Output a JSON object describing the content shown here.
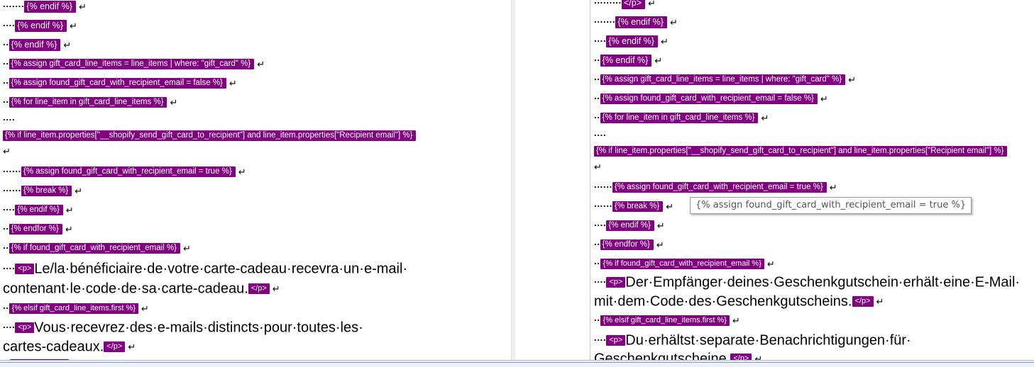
{
  "glyphs": {
    "return_icon": "↵",
    "dot": "·"
  },
  "colors": {
    "tag_bg": "#800080",
    "tag_text": "#ffffff"
  },
  "source": {
    "lines": [
      {
        "indent": "·······",
        "tag": "{% endif %}"
      },
      {
        "indent": "····",
        "tag": "{% endif %}"
      },
      {
        "indent": "··",
        "tag": "{% endif %}"
      },
      {
        "indent": "··",
        "tag": "{% assign gift_card_line_items = line_items | where: \"gift_card\" %}"
      },
      {
        "indent": "··",
        "tag": "{% assign found_gift_card_with_recipient_email = false %}"
      },
      {
        "indent": "··",
        "tag": "{% for line_item in gift_card_line_items %}"
      },
      {
        "indent": "····"
      },
      {
        "tag": "{% if line_item.properties[\"__shopify_send_gift_card_to_recipient\"] and line_item.properties[\"Recipient email\"] %}"
      },
      {
        "indent": "······",
        "tag": "{% assign found_gift_card_with_recipient_email = true %}"
      },
      {
        "indent": "······",
        "tag": "{% break %}"
      },
      {
        "indent": "····",
        "tag": "{% endif %}"
      },
      {
        "indent": "··",
        "tag": "{% endfor %}"
      },
      {
        "indent": "··",
        "tag": "{% if found_gift_card_with_recipient_email %}"
      },
      {
        "indent": "····",
        "open": "<p>",
        "text": "Le/la·bénéficiaire·de·votre·carte-cadeau·recevra·un·e-mail·"
      },
      {
        "text": "contenant·le·code·de·sa·carte-cadeau.",
        "close": "</p>"
      },
      {
        "indent": "··",
        "tag": "{% elsif gift_card_line_items.first %}"
      },
      {
        "indent": "····",
        "open": "<p>",
        "text": "Vous·recevrez·des·e-mails·distincts·pour·toutes·les·"
      },
      {
        "text": "cartes-cadeaux.",
        "close": "</p>"
      }
    ]
  },
  "target": {
    "lines": [
      {
        "indent": "·········",
        "tag": "</p>"
      },
      {
        "indent": "·······",
        "tag": "{% endif %}"
      },
      {
        "indent": "····",
        "tag": "{% endif %}"
      },
      {
        "indent": "··",
        "tag": "{% endif %}"
      },
      {
        "indent": "··",
        "tag": "{% assign gift_card_line_items = line_items | where: \"gift_card\" %}"
      },
      {
        "indent": "··",
        "tag": "{% assign found_gift_card_with_recipient_email = false %}"
      },
      {
        "indent": "··",
        "tag": "{% for line_item in gift_card_line_items %}"
      },
      {
        "indent": "····"
      },
      {
        "tag": "{% if line_item.properties[\"__shopify_send_gift_card_to_recipient\"] and line_item.properties[\"Recipient email\"] %}"
      },
      {
        "indent": "······",
        "tag": "{% assign found_gift_card_with_recipient_email = true %}"
      },
      {
        "indent": "······",
        "tag": "{% break %}"
      },
      {
        "indent": "····",
        "tag": "{% endif %}"
      },
      {
        "indent": "··",
        "tag": "{% endfor %}"
      },
      {
        "indent": "··",
        "tag": "{% if found_gift_card_with_recipient_email %}"
      },
      {
        "indent": "····",
        "open": "<p>",
        "text": "Der·Empfänger·deines·Geschenkgutschein·erhält·eine·E-Mail·"
      },
      {
        "text": "mit·dem·Code·des·Geschenkgutscheins.",
        "close": "</p>"
      },
      {
        "indent": "··",
        "tag": "{% elsif gift_card_line_items.first %}"
      },
      {
        "indent": "····",
        "open": "<p>",
        "text": "Du·erhältst·separate·Benachrichtigungen·für·"
      },
      {
        "text": "Geschenkgutscheine.",
        "close": "</p>"
      }
    ],
    "tooltip": "{% assign found_gift_card_with_recipient_email = true %}"
  }
}
